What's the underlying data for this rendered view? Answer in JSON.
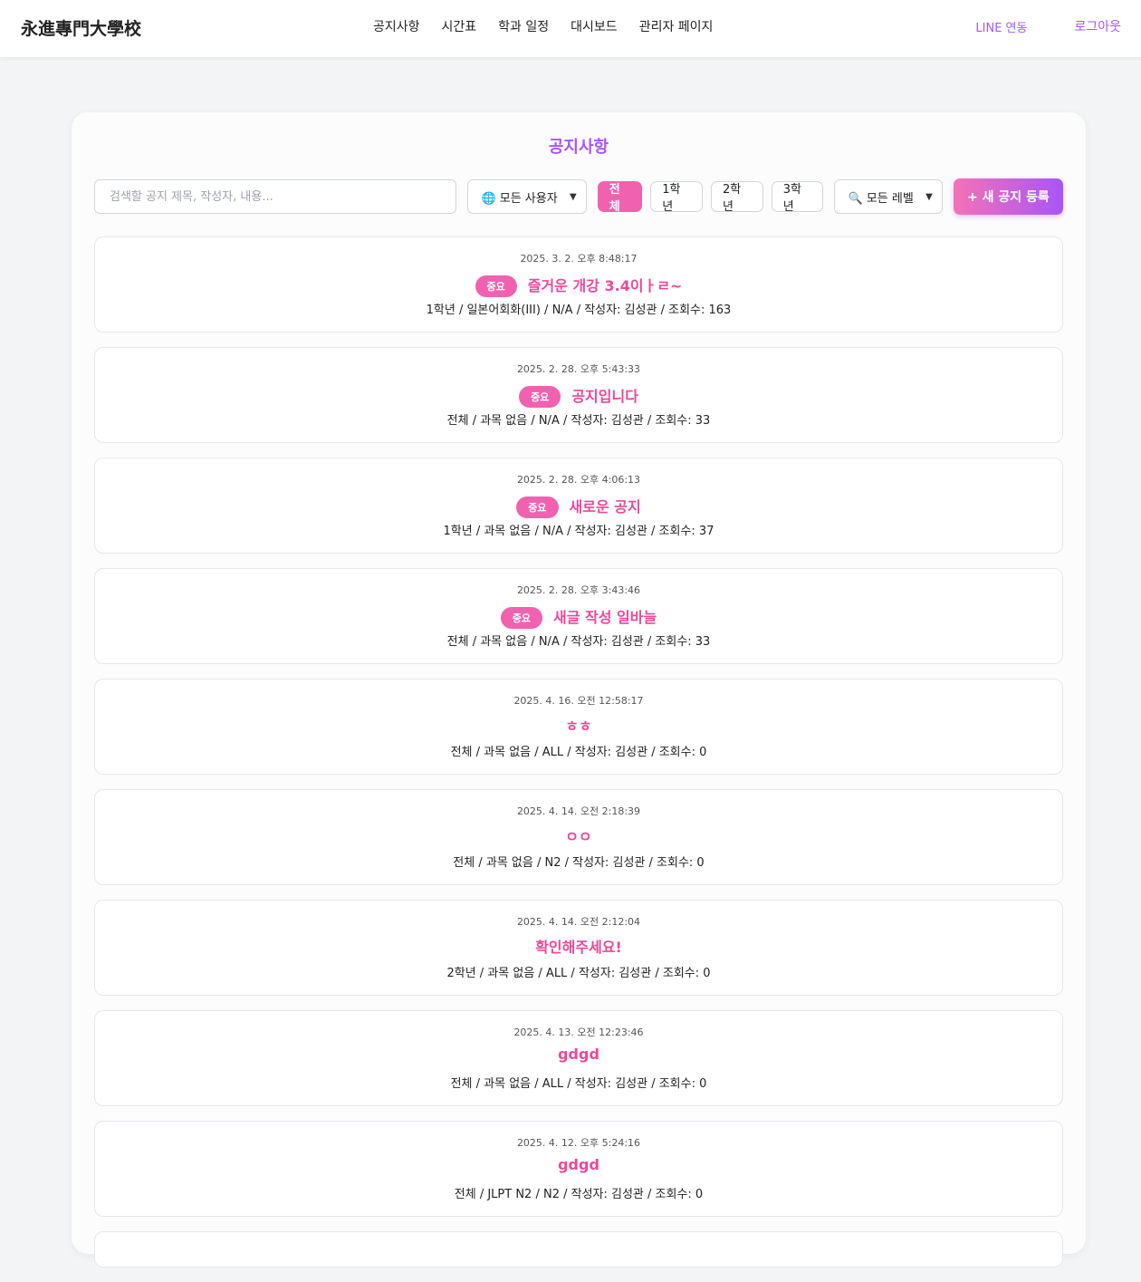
{
  "nav": {
    "brand": "永進專門大學校",
    "links": [
      "공지사항",
      "시간표",
      "학과 일정",
      "대시보드",
      "관리자 페이지"
    ],
    "line_label": "LINE 연동",
    "logout_label": "로그아웃"
  },
  "page": {
    "title": "공지사항"
  },
  "filters": {
    "search_placeholder": "검색할 공지 제목, 작성자, 내용...",
    "user_select": "🌐 모든 사용자",
    "grades": [
      "전체",
      "1학년",
      "2학년",
      "3학년"
    ],
    "active_grade": "전체",
    "level_select": "🔍 모든 레벨",
    "new_button": "+ 새 공지 등록"
  },
  "notices": [
    {
      "date": "2025. 3. 2. 오후 8:48:17",
      "important": true,
      "badge": "중요",
      "title": "즐거운 개강 3.4이ㅏㄹ~",
      "meta": "1학년 / 일본어회화(III) / N/A / 작성자: 김성관 / 조회수: 163"
    },
    {
      "date": "2025. 2. 28. 오후 5:43:33",
      "important": true,
      "badge": "중요",
      "title": "공지입니다",
      "meta": "전체 / 과목 없음 / N/A / 작성자: 김성관 / 조회수: 33"
    },
    {
      "date": "2025. 2. 28. 오후 4:06:13",
      "important": true,
      "badge": "중요",
      "title": "새로운 공지",
      "meta": "1학년 / 과목 없음 / N/A / 작성자: 김성관 / 조회수: 37"
    },
    {
      "date": "2025. 2. 28. 오후 3:43:46",
      "important": true,
      "badge": "중요",
      "title": "새글 작성 일바늘",
      "meta": "전체 / 과목 없음 / N/A / 작성자: 김성관 / 조회수: 33"
    },
    {
      "date": "2025. 4. 16. 오전 12:58:17",
      "important": false,
      "badge": "",
      "title": "ㅎㅎ",
      "meta": "전체 / 과목 없음 / ALL / 작성자: 김성관 / 조회수: 0"
    },
    {
      "date": "2025. 4. 14. 오전 2:18:39",
      "important": false,
      "badge": "",
      "title": "ㅇㅇ",
      "meta": "전체 / 과목 없음 / N2 / 작성자: 김성관 / 조회수: 0"
    },
    {
      "date": "2025. 4. 14. 오전 2:12:04",
      "important": false,
      "badge": "",
      "title": "확인해주세요!",
      "meta": "2학년 / 과목 없음 / ALL / 작성자: 김성관 / 조회수: 0"
    },
    {
      "date": "2025. 4. 13. 오전 12:23:46",
      "important": false,
      "badge": "",
      "title": "gdgd",
      "meta": "전체 / 과목 없음 / ALL / 작성자: 김성관 / 조회수: 0"
    },
    {
      "date": "2025. 4. 12. 오후 5:24:16",
      "important": false,
      "badge": "",
      "title": "gdgd",
      "meta": "전체 / JLPT N2 / N2 / 작성자: 김성관 / 조회수: 0"
    }
  ],
  "colors": {
    "accent_purple": "#a855f7",
    "accent_pink": "#ec4899",
    "badge_pink": "#f062b0"
  }
}
